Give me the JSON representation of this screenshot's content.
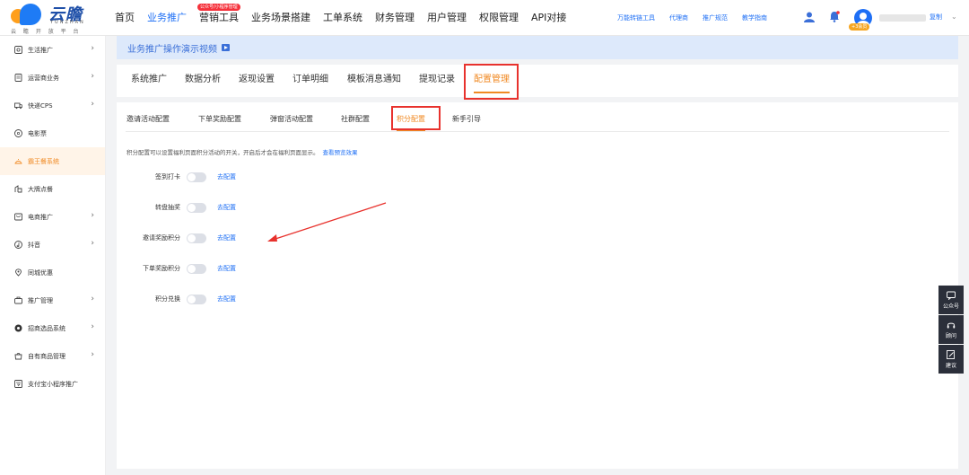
{
  "logo": {
    "text": "云瞻",
    "sub": "YUNZHAN",
    "tag": "云 瞻 开 放 平 台"
  },
  "main_nav": [
    {
      "label": "首页",
      "active": false
    },
    {
      "label": "业务推广",
      "active": true
    },
    {
      "label": "营销工具",
      "active": false,
      "badge": "公众号/小程序管理"
    },
    {
      "label": "业务场景搭建",
      "active": false
    },
    {
      "label": "工单系统",
      "active": false
    },
    {
      "label": "财务管理",
      "active": false
    },
    {
      "label": "用户管理",
      "active": false
    },
    {
      "label": "权限管理",
      "active": false
    },
    {
      "label": "API对接",
      "active": false
    }
  ],
  "right_nav": [
    "万能转链工具",
    "代理商",
    "推广规范",
    "教学指南"
  ],
  "user": {
    "vip_badge": "+3会员",
    "copy": "复制"
  },
  "sidebar": [
    {
      "label": "生活推广",
      "icon": "life-icon",
      "chevron": true
    },
    {
      "label": "运营商业务",
      "icon": "operator-icon",
      "chevron": true
    },
    {
      "label": "快递CPS",
      "icon": "delivery-icon",
      "chevron": true
    },
    {
      "label": "电影票",
      "icon": "movie-icon",
      "chevron": false
    },
    {
      "label": "霸王餐系统",
      "icon": "meal-icon",
      "chevron": false,
      "active": true
    },
    {
      "label": "大牌点餐",
      "icon": "brand-order-icon",
      "chevron": false
    },
    {
      "label": "电商推广",
      "icon": "ecommerce-icon",
      "chevron": true
    },
    {
      "label": "抖音",
      "icon": "douyin-icon",
      "chevron": true
    },
    {
      "label": "同城优惠",
      "icon": "location-icon",
      "chevron": false
    },
    {
      "label": "推广管理",
      "icon": "briefcase-icon",
      "chevron": true
    },
    {
      "label": "招商选品系统",
      "icon": "selection-icon",
      "chevron": true
    },
    {
      "label": "自有商品管理",
      "icon": "goods-icon",
      "chevron": true
    },
    {
      "label": "支付宝小程序推广",
      "icon": "alipay-icon",
      "chevron": false
    }
  ],
  "video_banner": "业务推广操作演示视频",
  "main_tabs": [
    {
      "label": "系统推广",
      "active": false
    },
    {
      "label": "数据分析",
      "active": false
    },
    {
      "label": "返现设置",
      "active": false
    },
    {
      "label": "订单明细",
      "active": false
    },
    {
      "label": "模板消息通知",
      "active": false
    },
    {
      "label": "提现记录",
      "active": false
    },
    {
      "label": "配置管理",
      "active": true
    }
  ],
  "sub_tabs": [
    {
      "label": "邀请活动配置",
      "active": false
    },
    {
      "label": "下单奖励配置",
      "active": false
    },
    {
      "label": "弹窗活动配置",
      "active": false
    },
    {
      "label": "社群配置",
      "active": false
    },
    {
      "label": "积分配置",
      "active": true
    },
    {
      "label": "新手引导",
      "active": false
    }
  ],
  "description": {
    "text": "积分配置可以设置福利页面积分活动的开关，开启后才会在福利页面显示。",
    "link": "查看预览效果"
  },
  "settings": [
    {
      "label": "签到打卡",
      "enabled": false,
      "link": "去配置"
    },
    {
      "label": "转盘抽奖",
      "enabled": false,
      "link": "去配置"
    },
    {
      "label": "邀请奖励积分",
      "enabled": false,
      "link": "去配置"
    },
    {
      "label": "下单奖励积分",
      "enabled": false,
      "link": "去配置"
    },
    {
      "label": "积分兑换",
      "enabled": false,
      "link": "去配置"
    }
  ],
  "float_buttons": [
    {
      "label": "公众号",
      "icon": "chat-icon"
    },
    {
      "label": "顾问",
      "icon": "headset-icon"
    },
    {
      "label": "建议",
      "icon": "edit-icon"
    }
  ],
  "colors": {
    "primary": "#1e6ff5",
    "accent": "#f08a24",
    "highlight": "#e8322d"
  }
}
